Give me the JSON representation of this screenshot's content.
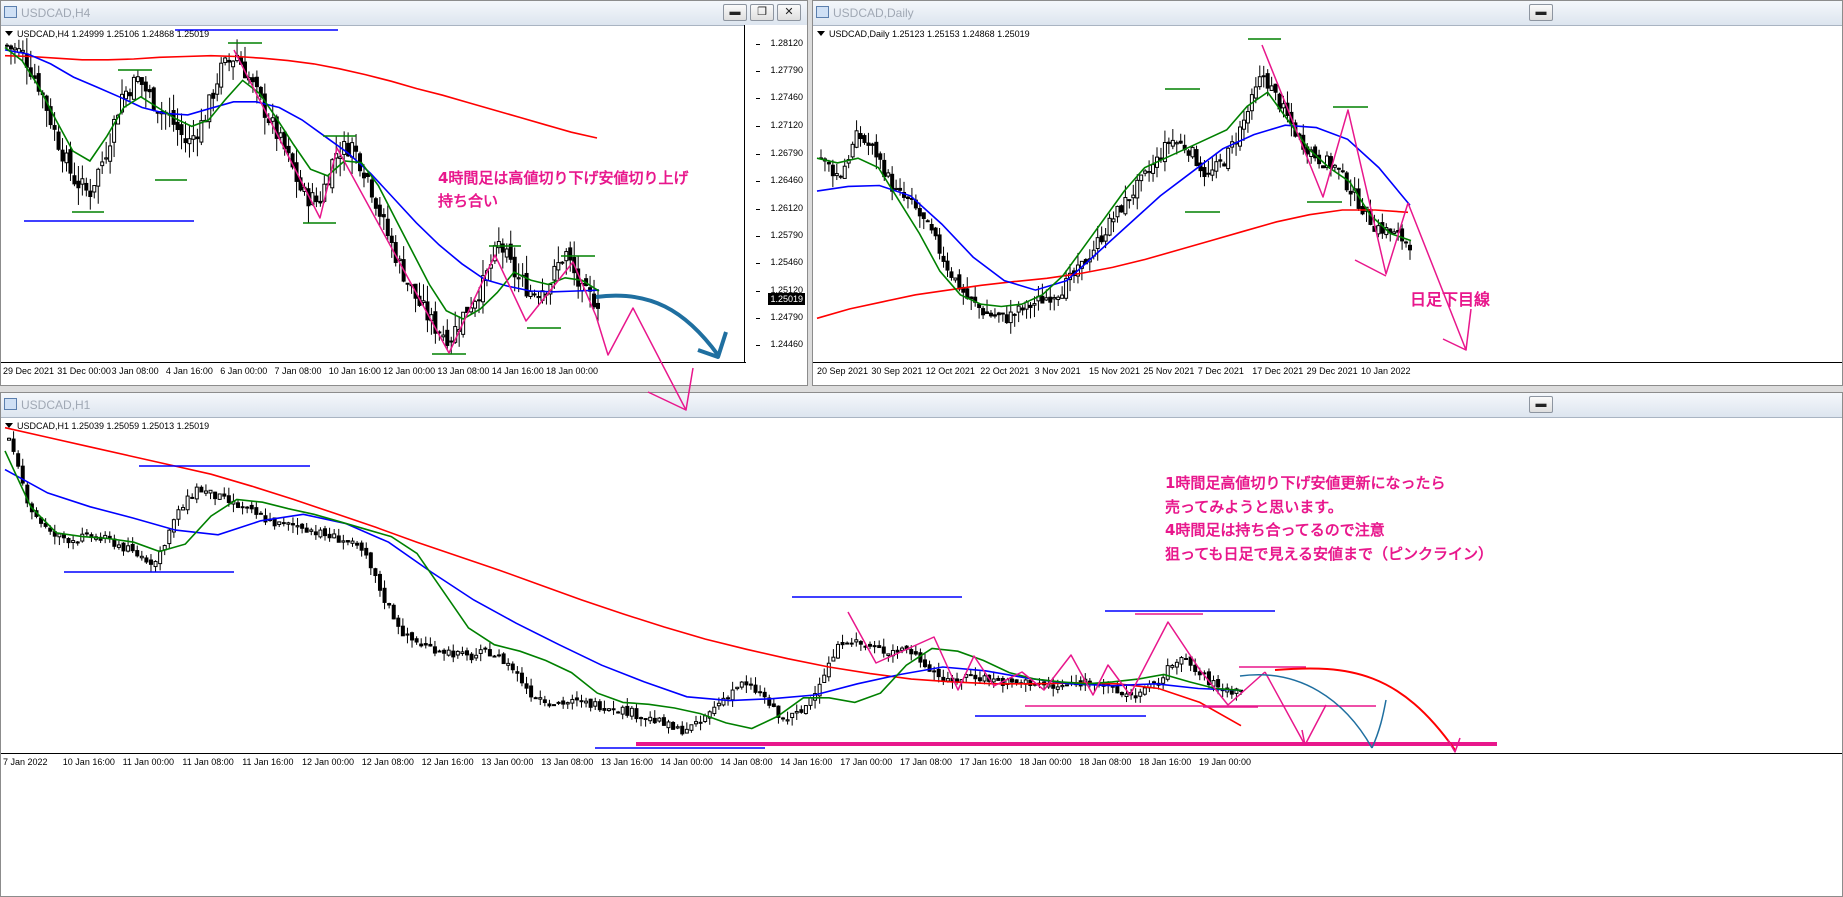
{
  "windows": [
    {
      "id": "h4",
      "title": "USDCAD,H4",
      "info": "USDCAD,H4  1.24999 1.25106 1.24868 1.25019",
      "buttons": [
        "minimize",
        "restore",
        "close"
      ],
      "chart_data": {
        "type": "candlestick",
        "symbol": "USDCAD",
        "timeframe": "H4",
        "ohlc_last": {
          "open": 1.24999,
          "high": 1.25106,
          "low": 1.24868,
          "close": 1.25019
        },
        "current_price": "1.25019",
        "ylim": [
          1.2433,
          1.2828
        ],
        "y_ticks": [
          "1.28120",
          "1.27790",
          "1.27460",
          "1.27120",
          "1.26790",
          "1.26460",
          "1.26120",
          "1.25790",
          "1.25460",
          "1.25120",
          "1.24790",
          "1.24460"
        ],
        "x_ticks": [
          "29 Dec 2021",
          "31 Dec 00:00",
          "3 Jan 08:00",
          "4 Jan 16:00",
          "6 Jan 00:00",
          "7 Jan 08:00",
          "10 Jan 16:00",
          "12 Jan 00:00",
          "13 Jan 08:00",
          "14 Jan 16:00",
          "18 Jan 00:00"
        ],
        "close_path": [
          1.281,
          1.28,
          1.276,
          1.27,
          1.265,
          1.263,
          1.268,
          1.275,
          1.277,
          1.274,
          1.272,
          1.269,
          1.272,
          1.278,
          1.28,
          1.276,
          1.272,
          1.268,
          1.263,
          1.262,
          1.268,
          1.269,
          1.265,
          1.259,
          1.254,
          1.25,
          1.247,
          1.2455,
          1.249,
          1.252,
          1.257,
          1.253,
          1.251,
          1.252,
          1.256,
          1.251,
          1.25
        ],
        "series": [
          {
            "color": "#ff0000",
            "values": [
              1.2798,
              1.2797,
              1.2795,
              1.2793,
              1.2793,
              1.2794,
              1.2796,
              1.2797,
              1.2798,
              1.2797,
              1.2795,
              1.2792,
              1.2788,
              1.2782,
              1.2775,
              1.2767,
              1.2758,
              1.275,
              1.2741,
              1.2732,
              1.2723,
              1.2714,
              1.2705,
              1.2698
            ]
          },
          {
            "color": "#0000ff",
            "values": [
              1.2805,
              1.28,
              1.2788,
              1.2772,
              1.276,
              1.2748,
              1.2735,
              1.2728,
              1.2726,
              1.2734,
              1.2742,
              1.2742,
              1.2735,
              1.272,
              1.27,
              1.268,
              1.2655,
              1.2625,
              1.2595,
              1.2568,
              1.2545,
              1.2526,
              1.2518,
              1.2512,
              1.2511,
              1.2512,
              1.2513
            ]
          },
          {
            "color": "#008000",
            "values": [
              1.2808,
              1.2792,
              1.276,
              1.272,
              1.2682,
              1.267,
              1.27,
              1.2735,
              1.2748,
              1.2735,
              1.2722,
              1.2712,
              1.272,
              1.2745,
              1.2768,
              1.2752,
              1.2722,
              1.269,
              1.266,
              1.2652,
              1.267,
              1.2668,
              1.264,
              1.26,
              1.256,
              1.252,
              1.2488,
              1.2478,
              1.249,
              1.251,
              1.2535,
              1.2525,
              1.252,
              1.2528,
              1.2525,
              1.2512
            ]
          }
        ]
      }
    },
    {
      "id": "d1",
      "title": "USDCAD,Daily",
      "info": "USDCAD,Daily  1.25123 1.25153 1.24868 1.25019",
      "buttons": [
        "minimize"
      ],
      "chart_data": {
        "type": "candlestick",
        "symbol": "USDCAD",
        "timeframe": "Daily",
        "ohlc_last": {
          "open": 1.25123,
          "high": 1.25153,
          "low": 1.24868,
          "close": 1.25019
        },
        "x_ticks": [
          "20 Sep 2021",
          "30 Sep 2021",
          "12 Oct 2021",
          "22 Oct 2021",
          "3 Nov 2021",
          "15 Nov 2021",
          "25 Nov 2021",
          "7 Dec 2021",
          "17 Dec 2021",
          "29 Dec 2021",
          "10 Jan 2022"
        ],
        "ylim": [
          1.23,
          1.299
        ],
        "close_path": [
          1.272,
          1.268,
          1.277,
          1.273,
          1.265,
          1.262,
          1.256,
          1.248,
          1.242,
          1.239,
          1.238,
          1.24,
          1.242,
          1.244,
          1.248,
          1.254,
          1.26,
          1.265,
          1.27,
          1.276,
          1.274,
          1.268,
          1.272,
          1.28,
          1.29,
          1.283,
          1.276,
          1.272,
          1.27,
          1.264,
          1.258,
          1.256,
          1.254
        ],
        "series": [
          {
            "color": "#ff0000",
            "values": [
              1.238,
              1.24,
              1.2415,
              1.243,
              1.244,
              1.245,
              1.2458,
              1.2465,
              1.2475,
              1.2488,
              1.2505,
              1.2525,
              1.2545,
              1.2565,
              1.2585,
              1.26,
              1.261,
              1.261,
              1.2605
            ]
          },
          {
            "color": "#0000ff",
            "values": [
              1.265,
              1.266,
              1.2662,
              1.264,
              1.258,
              1.251,
              1.246,
              1.244,
              1.246,
              1.252,
              1.258,
              1.264,
              1.269,
              1.274,
              1.277,
              1.279,
              1.2785,
              1.276,
              1.27,
              1.262
            ]
          },
          {
            "color": "#008000",
            "values": [
              1.272,
              1.271,
              1.272,
              1.27,
              1.263,
              1.256,
              1.248,
              1.243,
              1.241,
              1.2405,
              1.241,
              1.243,
              1.247,
              1.253,
              1.259,
              1.265,
              1.27,
              1.272,
              1.274,
              1.276,
              1.278,
              1.283,
              1.286,
              1.28,
              1.274,
              1.27,
              1.267,
              1.26,
              1.256,
              1.2545
            ]
          }
        ]
      }
    },
    {
      "id": "h1",
      "title": "USDCAD,H1",
      "info": "USDCAD,H1  1.25039 1.25059 1.25013 1.25019",
      "buttons": [
        "minimize"
      ],
      "chart_data": {
        "type": "candlestick",
        "symbol": "USDCAD",
        "timeframe": "H1",
        "ohlc_last": {
          "open": 1.25039,
          "high": 1.25059,
          "low": 1.25013,
          "close": 1.25019
        },
        "x_ticks": [
          "7 Jan 2022",
          "10 Jan 16:00",
          "11 Jan 00:00",
          "11 Jan 08:00",
          "11 Jan 16:00",
          "12 Jan 00:00",
          "12 Jan 08:00",
          "12 Jan 16:00",
          "13 Jan 00:00",
          "13 Jan 08:00",
          "13 Jan 16:00",
          "14 Jan 00:00",
          "14 Jan 08:00",
          "14 Jan 16:00",
          "17 Jan 00:00",
          "17 Jan 08:00",
          "17 Jan 16:00",
          "18 Jan 00:00",
          "18 Jan 08:00",
          "18 Jan 16:00",
          "19 Jan 00:00"
        ],
        "ylim": [
          1.244,
          1.279
        ],
        "close_path": [
          1.277,
          1.27,
          1.267,
          1.2665,
          1.2668,
          1.2662,
          1.265,
          1.264,
          1.269,
          1.272,
          1.271,
          1.27,
          1.269,
          1.268,
          1.268,
          1.267,
          1.2665,
          1.265,
          1.26,
          1.256,
          1.255,
          1.2545,
          1.2538,
          1.2545,
          1.253,
          1.25,
          1.249,
          1.249,
          1.2488,
          1.2485,
          1.2478,
          1.247,
          1.246,
          1.2465,
          1.249,
          1.251,
          1.25,
          1.247,
          1.248,
          1.252,
          1.256,
          1.255,
          1.2545,
          1.2548,
          1.253,
          1.251,
          1.252,
          1.2515,
          1.251,
          1.2512,
          1.2505,
          1.251,
          1.2515,
          1.25,
          1.2498,
          1.251,
          1.254,
          1.252,
          1.2505,
          1.2502
        ],
        "series": [
          {
            "color": "#ff0000",
            "values": [
              1.2785,
              1.2775,
              1.2765,
              1.2755,
              1.2745,
              1.2735,
              1.2722,
              1.2708,
              1.2693,
              1.2678,
              1.2662,
              1.2647,
              1.2632,
              1.2616,
              1.26,
              1.2585,
              1.2571,
              1.2558,
              1.2547,
              1.2537,
              1.2528,
              1.2521,
              1.2515,
              1.2512,
              1.251,
              1.251,
              1.2511,
              1.251,
              1.2505,
              1.249,
              1.2465
            ]
          },
          {
            "color": "#0000ff",
            "values": [
              1.274,
              1.2715,
              1.27,
              1.2688,
              1.2675,
              1.267,
              1.2685,
              1.2692,
              1.2682,
              1.2662,
              1.263,
              1.26,
              1.2575,
              1.2552,
              1.253,
              1.2512,
              1.2496,
              1.2492,
              1.2494,
              1.2498,
              1.251,
              1.252,
              1.2528,
              1.2524,
              1.2516,
              1.251,
              1.2508,
              1.251,
              1.2505,
              1.2503
            ]
          },
          {
            "color": "#008000",
            "values": [
              1.276,
              1.27,
              1.2672,
              1.2668,
              1.2666,
              1.2662,
              1.2652,
              1.266,
              1.269,
              1.2708,
              1.2705,
              1.2698,
              1.2692,
              1.2684,
              1.2676,
              1.2668,
              1.265,
              1.261,
              1.257,
              1.2552,
              1.2545,
              1.2535,
              1.2522,
              1.25,
              1.249,
              1.2488,
              1.2484,
              1.2478,
              1.2468,
              1.2462,
              1.2475,
              1.2495,
              1.2495,
              1.249,
              1.25,
              1.253,
              1.2548,
              1.2545,
              1.2535,
              1.2522,
              1.2515,
              1.2512,
              1.251,
              1.2512,
              1.2515,
              1.252,
              1.2512,
              1.2505,
              1.2503
            ]
          }
        ]
      }
    }
  ],
  "annotations": {
    "h4_note": "4時間足は高値切り下げ安値切り上げ\n持ち合い",
    "daily_note": "日足下目線",
    "h1_note": "1時間足高値切り下げ安値更新になったら\n売ってみようと思います。\n4時間足は持ち合ってるので注意\n狙っても日足で見える安値まで（ピンクライン）"
  },
  "colors": {
    "bull": "#ffffff",
    "bear": "#000000",
    "annotation": "#e8178c",
    "forecast": "#1f6fa0"
  }
}
